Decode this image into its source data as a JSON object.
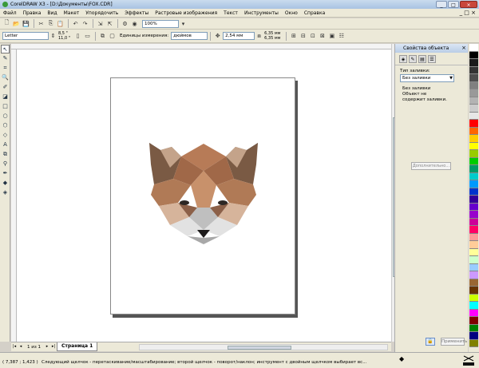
{
  "window": {
    "title": "CorelDRAW X3 - [D:\\Документы\\FOX.CDR]",
    "buttons": [
      "_",
      "□",
      "×"
    ]
  },
  "menu": {
    "items": [
      "Файл",
      "Правка",
      "Вид",
      "Макет",
      "Упорядочить",
      "Эффекты",
      "Растровые изображения",
      "Текст",
      "Инструменты",
      "Окно",
      "Справка"
    ],
    "right": "_ □ ×"
  },
  "toolbar1": {
    "zoom": "100%"
  },
  "toolbar2": {
    "page_size": "Letter",
    "width": "8,5 \"",
    "height": "11,0 \"",
    "units_label": "Единицы измерения:",
    "units_value": "дюймов",
    "nudge": "2,54 мм",
    "dup_x": "6,35 мм",
    "dup_y": "6,35 мм"
  },
  "toolbox": {
    "icons": [
      "pick-tool-icon",
      "shape-tool-icon",
      "crop-tool-icon",
      "zoom-tool-icon",
      "freehand-tool-icon",
      "smart-fill-tool-icon",
      "rectangle-tool-icon",
      "ellipse-tool-icon",
      "polygon-tool-icon",
      "basic-shapes-tool-icon",
      "text-tool-icon",
      "interactive-blend-tool-icon",
      "eyedropper-tool-icon",
      "outline-tool-icon",
      "fill-tool-icon",
      "interactive-fill-tool-icon"
    ],
    "glyphs": [
      "↖",
      "✎",
      "⌗",
      "🔍",
      "✐",
      "◪",
      "□",
      "○",
      "⬡",
      "◇",
      "A",
      "⧉",
      "⚲",
      "✒",
      "◆",
      "◈"
    ]
  },
  "pages": {
    "counter": "1 из 1",
    "tab": "Страница 1"
  },
  "status": {
    "coords": "( 7,387 ; 1,423 )",
    "hint": "Следующий щелчок - перетаскивание/масштабирование; второй щелчок - поворот/наклон; инструмент с двойным щелчком выбирает вс..."
  },
  "docker": {
    "title": "Свойства объекта",
    "fill_type_label": "Тип заливки:",
    "fill_type_value": "Без заливки",
    "no_fill": "Без заливки",
    "description": "Объект не содержит заливки.",
    "more_button": "Дополнительно...",
    "apply_button": "Применить"
  },
  "palette": {
    "colors": [
      "#ffffff",
      "#000000",
      "#1a1a1a",
      "#333333",
      "#4d4d4d",
      "#808080",
      "#999999",
      "#b3b3b3",
      "#cccccc",
      "#e6e6e6",
      "#ff0000",
      "#ff6600",
      "#ffcc00",
      "#ffff00",
      "#99cc00",
      "#00cc00",
      "#009966",
      "#00cccc",
      "#0099ff",
      "#0033cc",
      "#330099",
      "#6600cc",
      "#9900cc",
      "#cc0099",
      "#ff0066",
      "#ff9999",
      "#ffcc99",
      "#ffff99",
      "#ccffcc",
      "#99ccff",
      "#cc99ff",
      "#996633",
      "#663300",
      "#ccff00",
      "#00ffff",
      "#ff00ff",
      "#800000",
      "#008000",
      "#000080",
      "#808000"
    ]
  },
  "accent": "#a9c3e2"
}
